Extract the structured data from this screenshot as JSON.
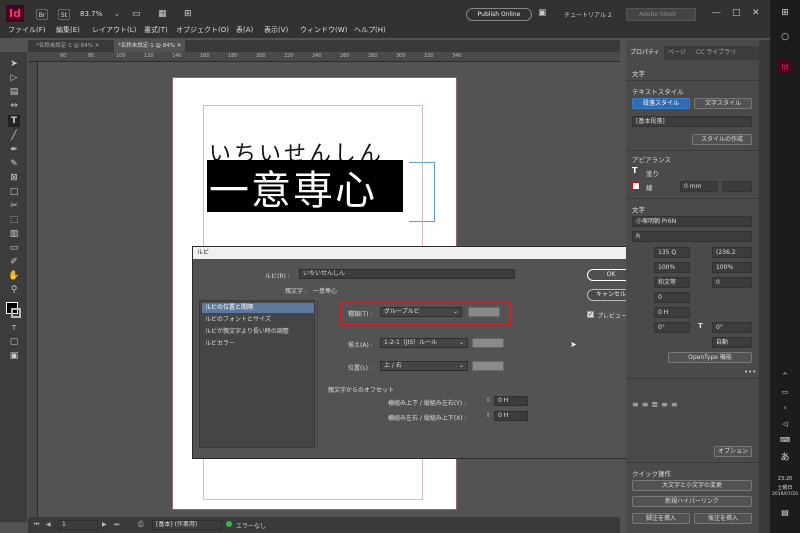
{
  "appbar": {
    "logo": "Id",
    "br": "Br",
    "st": "St",
    "zoom": "83.7%",
    "publish": "Publish Online",
    "tutorial": "チュートリアル 2",
    "search_placeholder": "Adobe Stock",
    "window_buttons": [
      "—",
      "□",
      "✕"
    ]
  },
  "menu": [
    "ファイル(F)",
    "編集(E)",
    "レイアウト(L)",
    "書式(T)",
    "オブジェクト(O)",
    "表(A)",
    "表示(V)",
    "ウィンドウ(W)",
    "ヘルプ(H)"
  ],
  "doc_tabs": [
    "*名称未設定-1 @ 84%  ✕",
    "*名称未設定-1 @ 84%  ✕"
  ],
  "ruler": [
    "60",
    "80",
    "100",
    "120",
    "140",
    "160",
    "180",
    "200",
    "220",
    "240",
    "260",
    "280",
    "300",
    "320",
    "340"
  ],
  "document": {
    "ruby_text": "いちいせんしん",
    "base_text": "一意専心"
  },
  "status": {
    "page": "1",
    "style": "[基本] (作業用)",
    "errors": "エラーなし"
  },
  "dialog": {
    "title": "ルビ",
    "ruby_label": "ルビ(R) :",
    "ruby_value": "いちいせんしん",
    "base_label": "親文字 :",
    "base_value": "一意専心",
    "ok": "OK",
    "cancel": "キャンセル",
    "preview": "プレビュー(P)",
    "preview_checked": true,
    "categories": [
      {
        "label": "ルビの位置と間隔",
        "selected": true
      },
      {
        "label": "ルビのフォントとサイズ",
        "selected": false
      },
      {
        "label": "ルビが親文字より長い時の調整",
        "selected": false
      },
      {
        "label": "ルビカラー",
        "selected": false
      }
    ],
    "type_label": "種類(T) :",
    "type_value": "グループルビ",
    "align_label": "揃え(A) :",
    "align_value": "1-2-1（JIS）ルール",
    "position_label": "位置(L) :",
    "position_value": "上 / 右",
    "offset_heading": "親文字からのオフセット",
    "offset_y_label": "横組み上下 / 縦組み左右(Y) :",
    "offset_y_value": "0 H",
    "offset_x_label": "横組み左右 / 縦組み上下(X) :",
    "offset_x_value": "0 H",
    "highlight_color": "#d0202a"
  },
  "panel": {
    "tabs": [
      "プロパティ",
      "ページ",
      "CC ライブラリ"
    ],
    "section_text": "文字",
    "text_style_heading": "テキストスタイル",
    "para_style_btn": "段落スタイル",
    "char_style_btn": "文字スタイル",
    "style_field": "[基本段落]",
    "create_style_btn": "スタイルの作成",
    "appearance_heading": "アピアランス",
    "fill_label": "塗り",
    "stroke_label": "線",
    "stroke_value": "0 mm",
    "char_heading": "文字",
    "font_value": "小塚明朝 Pr6N",
    "font_style": "R",
    "size_value": "135 Q",
    "leading_value": "(236.2",
    "scale_v": "100%",
    "scale_h": "100%",
    "tsume": "和文等",
    "zero1": "0",
    "zero2": "0",
    "baseline": "0 H",
    "skew": "0°",
    "rotate": "0°",
    "auto": "自動",
    "opentype_btn": "OpenType 機能",
    "options_btn": "オプション",
    "quick_actions": "クイック操作",
    "qa1": "大文字と小文字の変更",
    "qa2": "新規ハイパーリンク",
    "qa3": "脚注を挿入",
    "qa4": "後注を挿入",
    "accent_blue": "#2e6cb5"
  },
  "taskbar": {
    "time": "23:20",
    "day": "土曜日",
    "date": "2019/07/20",
    "ime": "あ"
  }
}
